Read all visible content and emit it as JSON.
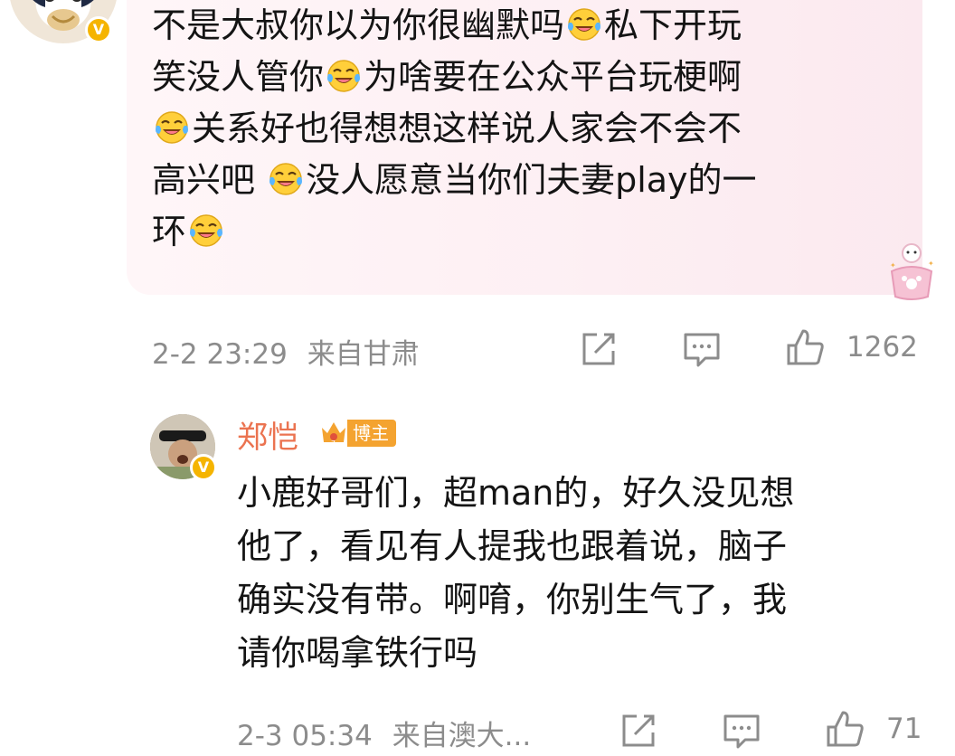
{
  "comment1": {
    "text_lines": [
      [
        "不是大叔你以为你很幽默吗",
        "[laugh-cry-emoji]",
        "私下开玩"
      ],
      [
        "笑没人管你",
        "[laugh-cry-emoji]",
        "为啥要在公众平台玩梗啊"
      ],
      [
        "[laugh-cry-emoji]",
        "关系好也得想想这样说人家会不会不"
      ],
      [
        "高兴吧 ",
        "[laugh-cry-emoji]",
        "没人愿意当你们夫妻play的一"
      ],
      [
        "环",
        "[laugh-cry-emoji]"
      ]
    ],
    "time": "2-2 23:29",
    "location": "来自甘肃",
    "like_count": "1262"
  },
  "comment2": {
    "username": "郑恺",
    "badge_label": "博主",
    "text_lines": [
      "小鹿好哥们，超man的，好久没见想",
      "他了，看见有人提我也跟着说，脑子",
      "确实没有带。啊唷，你别生气了，我",
      "请你喝拿铁行吗"
    ],
    "time": "2-3 05:34",
    "location": "来自澳大...",
    "like_count": "71"
  },
  "icons": {
    "share": "share-icon",
    "comment": "comment-icon",
    "like": "thumbs-up-icon",
    "verified": "verified-v-icon",
    "emoji": "laugh-cry-emoji"
  },
  "colors": {
    "username": "#eb7350",
    "meta": "#8c8c8c",
    "badge": "#f4a330",
    "verified": "#f5b400",
    "bubble": "#fdeff3"
  }
}
